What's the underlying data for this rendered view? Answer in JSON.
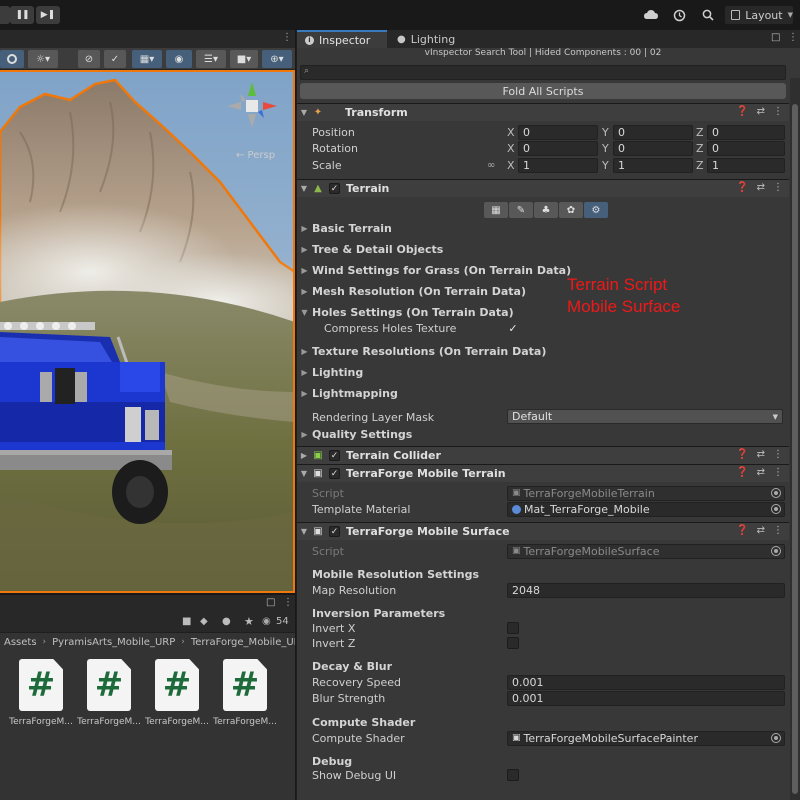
{
  "toolbar": {
    "pause_icon": "pause-icon",
    "step_icon": "step-icon",
    "layout_label": "Layout"
  },
  "scene": {
    "persp_label": "← Persp"
  },
  "project": {
    "eye_count": "54",
    "breadcrumb": [
      "Assets",
      "PyramisArts_Mobile_URP",
      "TerraForge_Mobile_URP"
    ],
    "files": [
      "TerraForgeM...",
      "TerraForgeM...",
      "TerraForgeM...",
      "TerraForgeM..."
    ],
    "file_glyph": "#"
  },
  "inspector": {
    "tabs": [
      "Inspector",
      "Lighting"
    ],
    "vinspector_line": "vInspector Search Tool | Hided Components : 00 | 02",
    "search_glyph": "⌕",
    "fold_all_label": "Fold All Scripts",
    "transform": {
      "title": "Transform",
      "axes": [
        "X",
        "Y",
        "Z"
      ],
      "rows": [
        {
          "label": "Position",
          "values": [
            "0",
            "0",
            "0"
          ]
        },
        {
          "label": "Rotation",
          "values": [
            "0",
            "0",
            "0"
          ]
        },
        {
          "label": "Scale",
          "values": [
            "1",
            "1",
            "1"
          ]
        }
      ]
    },
    "terrain": {
      "title": "Terrain",
      "foldouts": [
        "Basic Terrain",
        "Tree & Detail Objects",
        "Wind Settings for Grass (On Terrain Data)",
        "Mesh Resolution (On Terrain Data)",
        "Holes Settings (On Terrain Data)"
      ],
      "compress_holes_label": "Compress Holes Texture",
      "foldouts2": [
        "Texture Resolutions (On Terrain Data)",
        "Lighting",
        "Lightmapping"
      ],
      "rendering_layer_label": "Rendering Layer Mask",
      "rendering_layer_value": "Default",
      "quality_label": "Quality Settings"
    },
    "annotation": [
      "Terrain Script",
      "Mobile Surface"
    ],
    "terrain_collider": {
      "title": "Terrain Collider"
    },
    "tf_terrain": {
      "title": "TerraForge Mobile Terrain",
      "script_label": "Script",
      "script_value": "TerraForgeMobileTerrain",
      "template_label": "Template Material",
      "template_value": "Mat_TerraForge_Mobile"
    },
    "tf_surface": {
      "title": "TerraForge Mobile Surface",
      "script_label": "Script",
      "script_value": "TerraForgeMobileSurface",
      "res_section": "Mobile Resolution Settings",
      "map_res_label": "Map Resolution",
      "map_res_value": "2048",
      "inv_section": "Inversion Parameters",
      "invert_x_label": "Invert X",
      "invert_z_label": "Invert Z",
      "decay_section": "Decay & Blur",
      "recovery_label": "Recovery Speed",
      "recovery_value": "0.001",
      "blur_label": "Blur Strength",
      "blur_value": "0.001",
      "cs_section": "Compute Shader",
      "cs_label": "Compute Shader",
      "cs_value": "TerraForgeMobileSurfacePainter",
      "debug_section": "Debug",
      "debug_label": "Show Debug UI"
    }
  }
}
